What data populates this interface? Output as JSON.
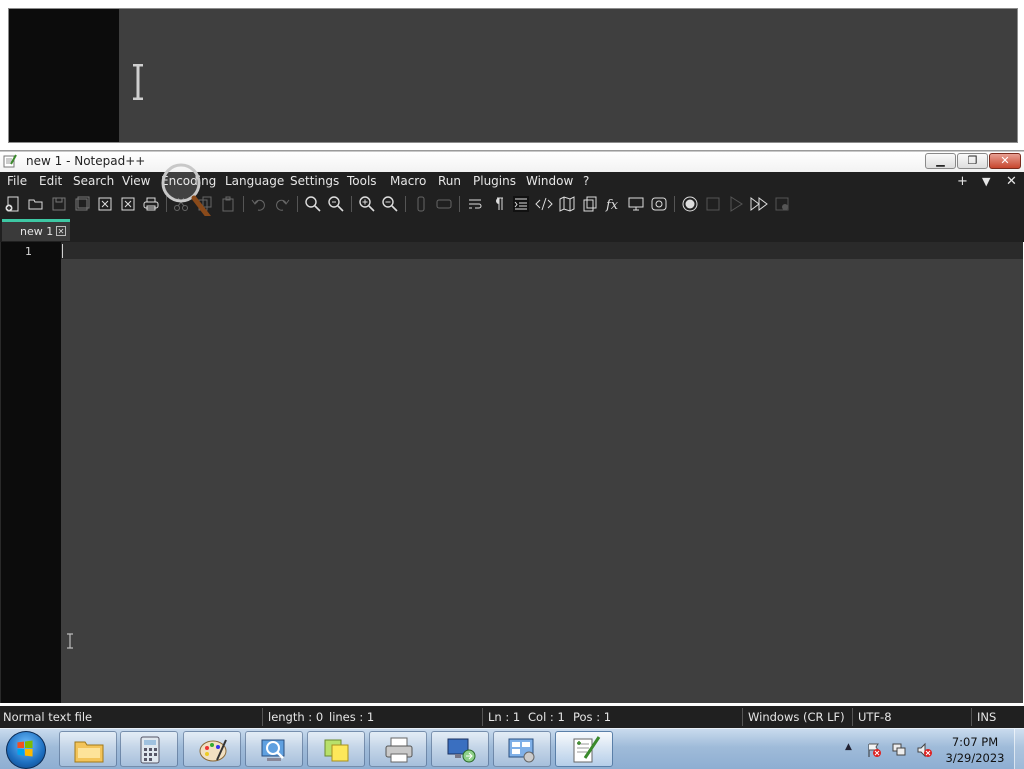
{
  "window": {
    "title": "new 1 - Notepad++",
    "min_label": "▁",
    "max_label": "❐",
    "close_label": "✕"
  },
  "menu": {
    "items": [
      "File",
      "Edit",
      "Search",
      "View",
      "Encoding",
      "Language",
      "Settings",
      "Tools",
      "Macro",
      "Run",
      "Plugins",
      "Window",
      "?"
    ],
    "right": {
      "add": "+",
      "dropdown": "▼",
      "close": "✕"
    }
  },
  "toolbar": {
    "icons": [
      "new-file-icon",
      "open-file-icon",
      "save-icon",
      "save-all-icon",
      "close-icon",
      "close-all-icon",
      "print-icon",
      "cut-icon",
      "copy-icon",
      "paste-icon",
      "undo-icon",
      "redo-icon",
      "find-icon",
      "replace-icon",
      "zoom-in-icon",
      "zoom-out-icon",
      "sync-vertical-icon",
      "sync-horizontal-icon",
      "word-wrap-icon",
      "show-all-chars-icon",
      "indent-guide-icon",
      "xml-tag-icon",
      "document-map-icon",
      "document-list-icon",
      "function-list-icon",
      "folder-as-workspace-icon",
      "monitoring-icon",
      "record-macro-icon",
      "stop-macro-icon",
      "play-macro-icon",
      "run-macro-multiple-icon",
      "save-macro-icon"
    ]
  },
  "tabs": [
    {
      "label": "new 1",
      "close": "✕"
    }
  ],
  "editor": {
    "line_numbers": [
      "1"
    ],
    "content": ""
  },
  "status": {
    "file_type": "Normal text file",
    "length": "length : 0",
    "lines": "lines : 1",
    "ln": "Ln : 1",
    "col": "Col : 1",
    "pos": "Pos : 1",
    "eol": "Windows (CR LF)",
    "encoding": "UTF-8",
    "mode": "INS"
  },
  "taskbar": {
    "apps": [
      "windows-explorer",
      "calculator",
      "paint",
      "network-search",
      "sticky-notes",
      "printer",
      "remote-desktop",
      "control-panel",
      "notepad-plus-plus"
    ],
    "clock": {
      "time": "7:07 PM",
      "date": "3/29/2023"
    },
    "tray_arrow": "▲"
  },
  "colors": {
    "menu_bg": "#202020",
    "editor_bg": "#3f3f3f",
    "gutter_bg": "#0c0c0c",
    "tab_accent": "#3ec8a4"
  }
}
